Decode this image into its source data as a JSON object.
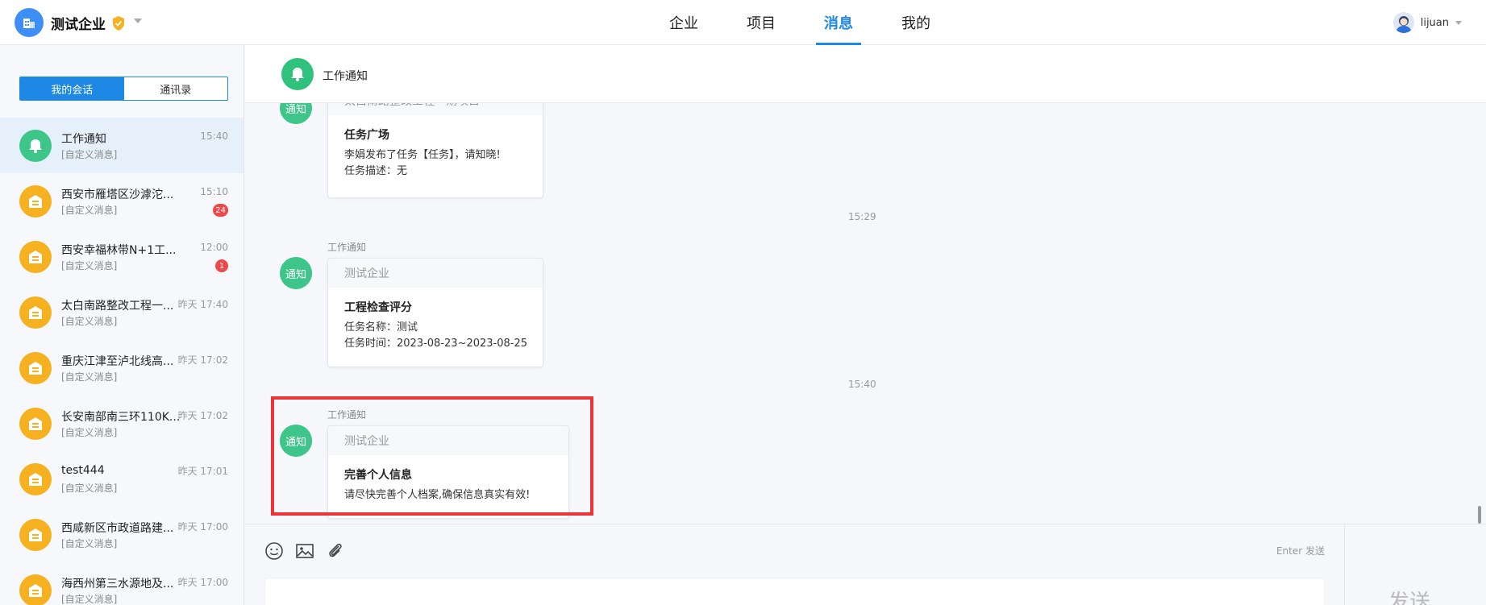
{
  "header": {
    "company_name": "测试企业",
    "nav": [
      "企业",
      "项目",
      "消息",
      "我的"
    ],
    "active_nav": "消息",
    "username": "lijuan"
  },
  "sidebar": {
    "tabs": [
      "我的会话",
      "通讯录"
    ],
    "conversations": [
      {
        "name": "工作通知",
        "sub": "[自定义消息]",
        "time": "15:40",
        "badge": "",
        "type": "bell"
      },
      {
        "name": "西安市雁塔区沙滹沱...",
        "sub": "[自定义消息]",
        "time": "15:10",
        "badge": "24",
        "type": "project"
      },
      {
        "name": "西安幸福林带N+1工...",
        "sub": "[自定义消息]",
        "time": "12:00",
        "badge": "1",
        "type": "project"
      },
      {
        "name": "太白南路整改工程一...",
        "sub": "[自定义消息]",
        "time": "昨天 17:40",
        "badge": "",
        "type": "project"
      },
      {
        "name": "重庆江津至泸北线高...",
        "sub": "[自定义消息]",
        "time": "昨天 17:02",
        "badge": "",
        "type": "project"
      },
      {
        "name": "长安南部南三环110K...",
        "sub": "[自定义消息]",
        "time": "昨天 17:02",
        "badge": "",
        "type": "project"
      },
      {
        "name": "test444",
        "sub": "[自定义消息]",
        "time": "昨天 17:01",
        "badge": "",
        "type": "project"
      },
      {
        "name": "西咸新区市政道路建...",
        "sub": "[自定义消息]",
        "time": "昨天 17:00",
        "badge": "",
        "type": "project"
      },
      {
        "name": "海西州第三水源地及...",
        "sub": "[自定义消息]",
        "time": "昨天 17:00",
        "badge": "",
        "type": "project"
      }
    ]
  },
  "chat": {
    "title": "工作通知",
    "avatar_label": "通知",
    "messages": [
      {
        "sender": "",
        "card_head": "太白南路整改工程一期项目",
        "title": "任务广场",
        "lines": [
          "李娟发布了任务【任务】，请知晓!",
          "任务描述：无"
        ]
      },
      {
        "time": "15:29",
        "sender": "工作通知",
        "card_head": "测试企业",
        "title": "工程检查评分",
        "lines": [
          "任务名称：测试",
          "任务时间：2023-08-23~2023-08-25"
        ]
      },
      {
        "time": "15:40",
        "sender": "工作通知",
        "card_head": "测试企业",
        "title": "完善个人信息",
        "lines": [
          "请尽快完善个人档案,确保信息真实有效!"
        ]
      }
    ]
  },
  "input": {
    "enter_hint": "Enter 发送",
    "send_label": "发送"
  },
  "colors": {
    "accent": "#1e88e5",
    "notice_green": "#3ec58a",
    "project_orange": "#f5b120",
    "badge_red": "#f04848",
    "highlight_red": "#ee3338"
  }
}
